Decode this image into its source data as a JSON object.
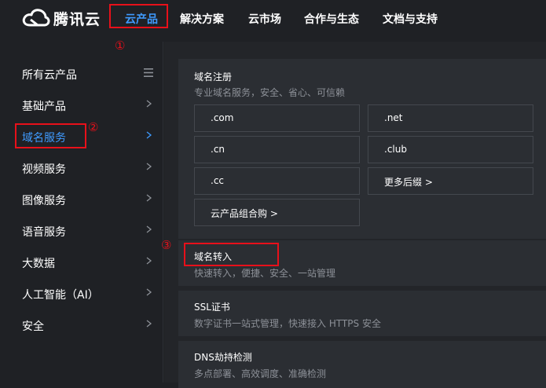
{
  "brand": {
    "name": "腾讯云"
  },
  "top_nav": {
    "items": [
      {
        "label": "云产品",
        "active": true
      },
      {
        "label": "解决方案"
      },
      {
        "label": "云市场"
      },
      {
        "label": "合作与生态"
      },
      {
        "label": "文档与支持"
      }
    ]
  },
  "annotations": [
    "①",
    "②",
    "③"
  ],
  "sidebar": {
    "items": [
      {
        "label": "所有云产品",
        "icon": "menu-icon"
      },
      {
        "label": "基础产品"
      },
      {
        "label": "域名服务",
        "active": true
      },
      {
        "label": "视频服务"
      },
      {
        "label": "图像服务"
      },
      {
        "label": "语音服务"
      },
      {
        "label": "大数据"
      },
      {
        "label": "人工智能（AI）"
      },
      {
        "label": "安全"
      }
    ]
  },
  "main": {
    "domain_registration": {
      "title": "域名注册",
      "desc": "专业域名服务，安全、省心、可信赖",
      "options": [
        ".com",
        ".net",
        ".cn",
        ".club",
        ".cc",
        "更多后缀 >",
        "云产品组合购 >"
      ]
    },
    "domain_transfer": {
      "title": "域名转入",
      "desc": "快速转入，便捷、安全、一站管理"
    },
    "ssl": {
      "title": "SSL证书",
      "desc": "数字证书一站式管理，快速接入 HTTPS 安全"
    },
    "dns": {
      "title": "DNS劫持检测",
      "desc": "多点部署、高效调度、准确检测"
    }
  },
  "colors": {
    "background": "#1f2125",
    "panel": "#232529",
    "card": "#2b2e33",
    "accent": "#3f9bff",
    "annotation": "#e8101a",
    "muted_text": "#8c9097"
  }
}
